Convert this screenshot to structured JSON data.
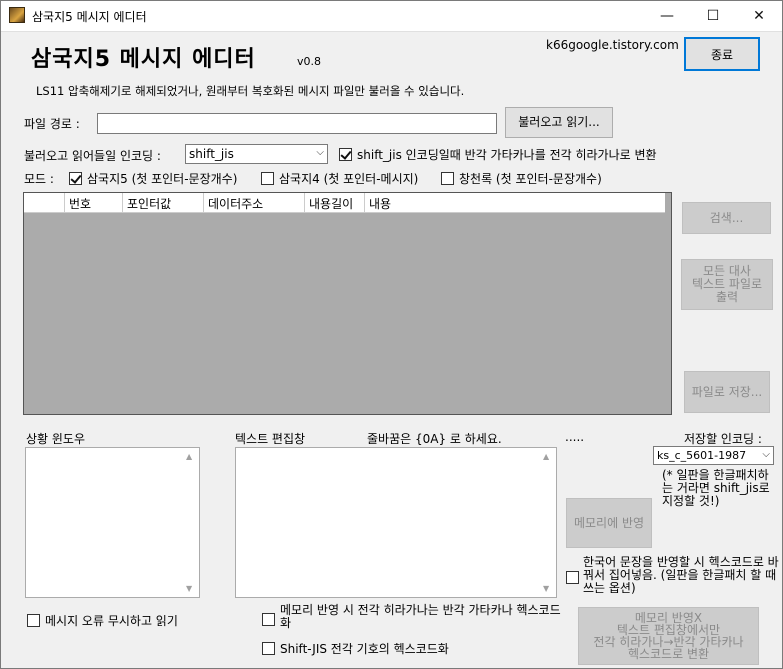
{
  "window": {
    "title": "삼국지5 메시지 에디터",
    "minimize": "—",
    "maximize": "☐",
    "close": "✕"
  },
  "header": {
    "title": "삼국지5 메시지 에디터",
    "version": "v0.8",
    "site": "k66google.tistory.com",
    "exit_label": "종료",
    "description": "LS11 압축해제기로 해제되었거나, 원래부터 복호화된 메시지 파일만 불러올 수 있습니다."
  },
  "file": {
    "path_label": "파일 경로 :",
    "path_value": "",
    "load_button": "불러오고 읽기..."
  },
  "encoding": {
    "label": "불러오고 읽어들일 인코딩 :",
    "selected": "shift_jis",
    "convert_label": "shift_jis 인코딩일때 반각 가타카나를 전각 히라가나로 변환",
    "convert_checked": true
  },
  "mode": {
    "label": "모드 :",
    "options": [
      {
        "label": "삼국지5 (첫 포인터-문장개수)",
        "checked": true
      },
      {
        "label": "삼국지4 (첫 포인터-메시지)",
        "checked": false
      },
      {
        "label": "창천록 (첫 포인터-문장개수)",
        "checked": false
      }
    ]
  },
  "table": {
    "columns": [
      "",
      "번호",
      "포인터값",
      "데이터주소",
      "내용길이",
      "내용"
    ],
    "rows": []
  },
  "side_buttons": {
    "search": "검색...",
    "export_all": "모든 대사\n텍스트 파일로\n출력",
    "save_file": "파일로 저장..."
  },
  "status": {
    "label": "상황 윈도우",
    "ignore_errors_label": "메시지 오류 무시하고 읽기",
    "ignore_errors_checked": false
  },
  "editor": {
    "label": "텍스트 편집창",
    "hint": "줄바꿈은 {0A} 로 하세요.",
    "dots": ".....",
    "value": "",
    "hexcode_kana_label": "메모리 반영 시 전각 히라가나는 반각 가타카나 헥스코드화",
    "hexcode_kana_checked": false,
    "hexcode_symbol_label": "Shift-JIS 전각 기호의 헥스코드화",
    "hexcode_symbol_checked": false
  },
  "save_encoding": {
    "label": "저장할 인코딩 :",
    "selected": "ks_c_5601-1987",
    "note": "(* 일판을 한글패치하는 거라면 shift_jis로 지정할 것!)"
  },
  "memory": {
    "apply_button": "메모리에 반영",
    "korean_hex_label": "한국어 문장을 반영할 시 헥스코드로 바꿔서 집어넣음. (일판을 한글패치 할 때 쓰는 옵션)",
    "korean_hex_checked": false,
    "apply_no_hex_button": "메모리 반영X\n텍스트 편집창에서만\n전각 히라가나→반각 가타카나\n헥스코드로 변환"
  }
}
